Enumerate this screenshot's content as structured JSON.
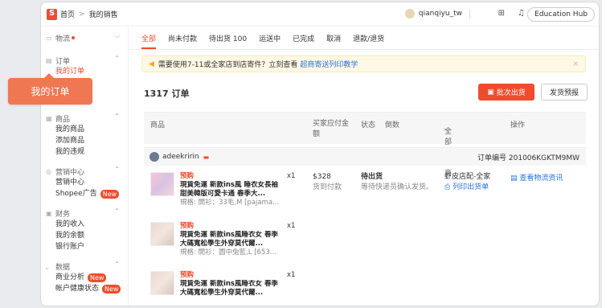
{
  "topbar": {
    "home": "首页",
    "sep": ">",
    "page": "我的销售",
    "username": "qianqiyu_tw",
    "hub": "Education Hub"
  },
  "callout": "我的订单",
  "sidebar": {
    "logistics": "物流",
    "orders": "订单",
    "my_orders": "我的订单",
    "products": "商品",
    "my_products": "我的商品",
    "add_product": "添加商品",
    "violations": "我的违规",
    "marketing": "营销中心",
    "marketing_center": "营销中心",
    "shopee_ads": "Shopee广告",
    "finance": "财务",
    "my_income": "我的收入",
    "my_balance": "我的余额",
    "bank_account": "银行账户",
    "data": "数据",
    "business_analysis": "商业分析",
    "account_health": "帐户健康状态",
    "new": "New"
  },
  "tabs": [
    "全部",
    "尚未付款",
    "待出货 100",
    "运送中",
    "已完成",
    "取消",
    "退款/退货"
  ],
  "notice": {
    "text": "需要使用7-11或全家店到店寄件？立刻查看",
    "link": "超商寄送列印教学",
    "close": "×"
  },
  "order_count": "1317 订单",
  "buttons": {
    "batch_ship": "批次出货",
    "pre_ship": "发货预报"
  },
  "columns": {
    "product": "商品",
    "buyer_pay": "买家应付金额",
    "status": "状态",
    "countdown": "倒数",
    "all_logistics": "全部物流商",
    "action": "操作"
  },
  "order": {
    "buyer": "adeekririn",
    "number": "订单编号 201006KGKTM9MW",
    "price": "$328",
    "pay_method": "货到付款",
    "status": "待出货",
    "status_note": "等待快递员确认发货。",
    "carrier": "虾皮店配-全家",
    "print_label": "列印出货单",
    "view_logistics": "查看物流资讯",
    "items": [
      {
        "tag": "预购",
        "title": "現貨免運 新款ins風 睡衣女長袖甜美韓版可愛卡通 春季大...",
        "spec": "規格: 開衫：33毛,M [pajama...",
        "qty": "x1"
      },
      {
        "tag": "预购",
        "title": "現貨免運 新款ins風睡衣女 春季大碼寬松學生外穿莫代爾...",
        "spec": "規格: 開衫：圖中兔藍,L [653...",
        "qty": "x1"
      },
      {
        "tag": "预购",
        "title": "現貨免運 新款ins風睡衣女 春季大碼寬松學生外穿莫代爾...",
        "spec": "",
        "qty": "x1"
      }
    ]
  }
}
